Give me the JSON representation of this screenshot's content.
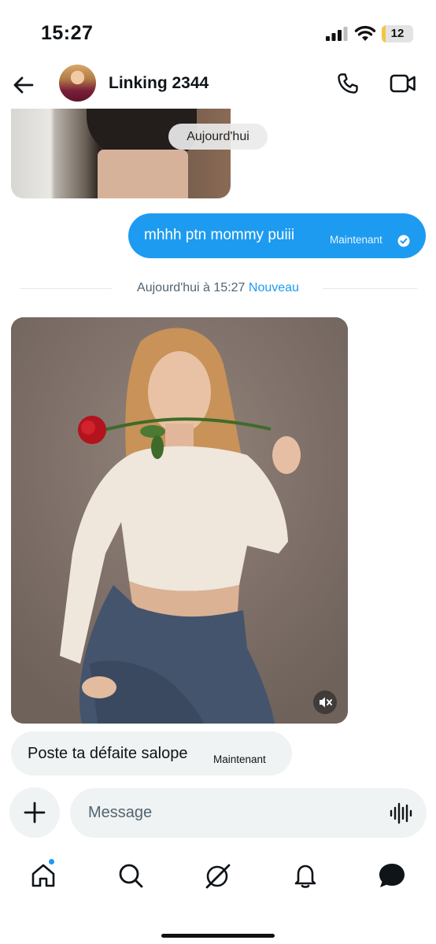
{
  "status_bar": {
    "time": "15:27",
    "battery_level": "12",
    "battery_fraction": 0.12
  },
  "header": {
    "contact_name": "Linking 2344"
  },
  "chat": {
    "day_separator": "Aujourd'hui",
    "outgoing": {
      "text": "mhhh ptn mommy puiii",
      "time": "Maintenant"
    },
    "unread_divider": {
      "label": "Aujourd'hui à 15:27",
      "new_label": "Nouveau"
    },
    "incoming": {
      "text": "Poste ta défaite salope",
      "time": "Maintenant"
    }
  },
  "composer": {
    "placeholder": "Message"
  },
  "nav": {
    "items": [
      "home-icon",
      "search-icon",
      "grok-icon",
      "notifications-icon",
      "messages-icon"
    ]
  },
  "colors": {
    "accent": "#1d9bf0",
    "bubble_incoming": "#eff3f4",
    "text_secondary": "#536471"
  }
}
